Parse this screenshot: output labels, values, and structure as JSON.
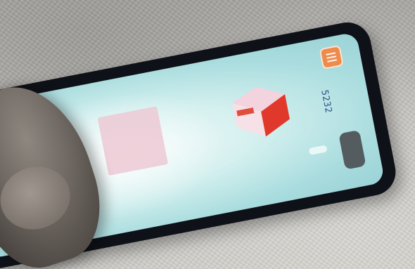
{
  "scene": {
    "description_visible_text": "",
    "score_text": "5232",
    "colors": {
      "screen_bg": "#bfe7e8",
      "tile": "#ecc9d3",
      "cube_red": "#e0382b",
      "cube_pink": "#f3d3dd",
      "menu_button": "#ee8a4c",
      "score_text": "#2f4f8a"
    },
    "icons": [
      "menu-icon"
    ]
  }
}
